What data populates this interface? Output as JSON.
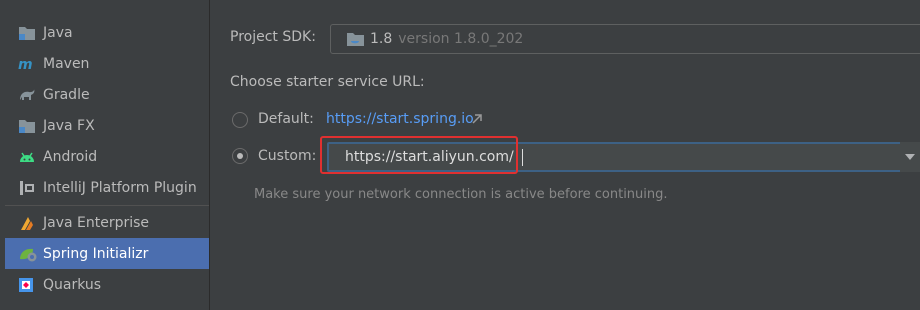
{
  "sidebar": {
    "items": [
      {
        "label": "Java",
        "icon": "folder-icon"
      },
      {
        "label": "Maven",
        "icon": "maven-icon"
      },
      {
        "label": "Gradle",
        "icon": "gradle-icon"
      },
      {
        "label": "Java FX",
        "icon": "folder-icon"
      },
      {
        "label": "Android",
        "icon": "android-icon"
      },
      {
        "label": "IntelliJ Platform Plugin",
        "icon": "plugin-icon"
      },
      {
        "label": "Java Enterprise",
        "icon": "java-enterprise-icon"
      },
      {
        "label": "Spring Initializr",
        "icon": "spring-icon",
        "selected": true
      },
      {
        "label": "Quarkus",
        "icon": "quarkus-icon"
      }
    ]
  },
  "main": {
    "sdk_label": "Project SDK:",
    "sdk_version": "1.8",
    "sdk_full": "version 1.8.0_202",
    "starter_label": "Choose starter service URL:",
    "default_label": "Default:",
    "default_url": "https://start.spring.io",
    "custom_label": "Custom:",
    "custom_url": "https://start.aliyun.com/",
    "hint": "Make sure your network connection is active before continuing."
  },
  "colors": {
    "background": "#3c3f41",
    "selection": "#4b6eaf",
    "link": "#589df6",
    "highlight_box": "#e03030"
  }
}
